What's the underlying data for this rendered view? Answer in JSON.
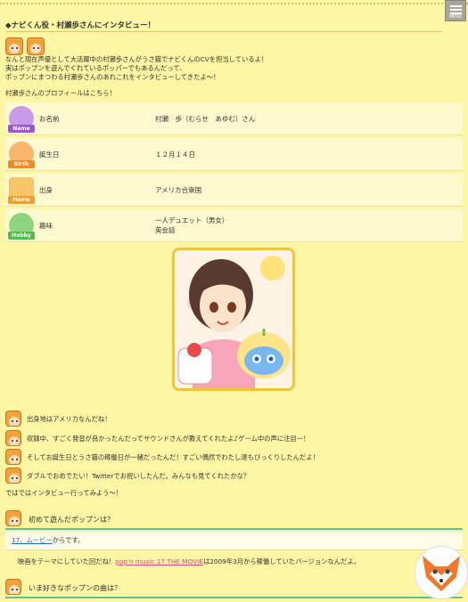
{
  "header": {
    "menu_label": "MENU",
    "title": "◆ナビくん役・村瀬歩さんにインタビュー！"
  },
  "intro": {
    "line1": "なんと現在声優として大活躍中の村瀬歩さんがうさ猫でナビくんのCVを担当しているよ！",
    "line2": "実はポップンを遊んでくれているポッパーでもあるんだって、",
    "line3": "ポップンにまつわる村瀬歩さんのあれこれをインタビューしてきたよ〜！",
    "profile_lead": "村瀬歩さんのプロフィールはこちら！"
  },
  "profile": [
    {
      "badge": "Name",
      "key": "お名前",
      "value": "村瀬　歩（むらせ　あゆむ）さん",
      "color": "#9b59d0"
    },
    {
      "badge": "Birth",
      "key": "誕生日",
      "value": "１２月１４日",
      "color": "#f28a2a"
    },
    {
      "badge": "Home",
      "key": "出身",
      "value": "アメリカ合衆国",
      "color": "#f0a030"
    },
    {
      "badge": "Hobby",
      "key": "趣味",
      "value": "一人デュエット（男女）",
      "value2": "英会話",
      "color": "#58b848"
    }
  ],
  "talk": [
    "出身地はアメリカなんだね！",
    "収録中、すごく発音が良かったんだってサウンドさんが教えてくれたよ♪ゲーム中の声に注目ー！",
    "そしてお誕生日とうさ猫の稼働日が一緒だったんだ！すごい偶然でわたし達もびっくりしたんだよ！",
    "ダブルでおめでたい！Twitterでお祝いしたんだ。みんなも見てくれたかな？"
  ],
  "lead_in": "ではではインタビュー行ってみよう〜！",
  "q1": {
    "question": "初めて遊んだポップンは？",
    "answer_link": "17、ムービー",
    "answer_rest": "からです。",
    "comment_pre": "映画をテーマにしていた回だね！",
    "comment_link": "pop'n music 17 THE MOVIE",
    "comment_post": "は2009年3月から稼働していたバージョンなんだよ。"
  },
  "q2": {
    "question": "いま好きなポップンの曲は？"
  }
}
